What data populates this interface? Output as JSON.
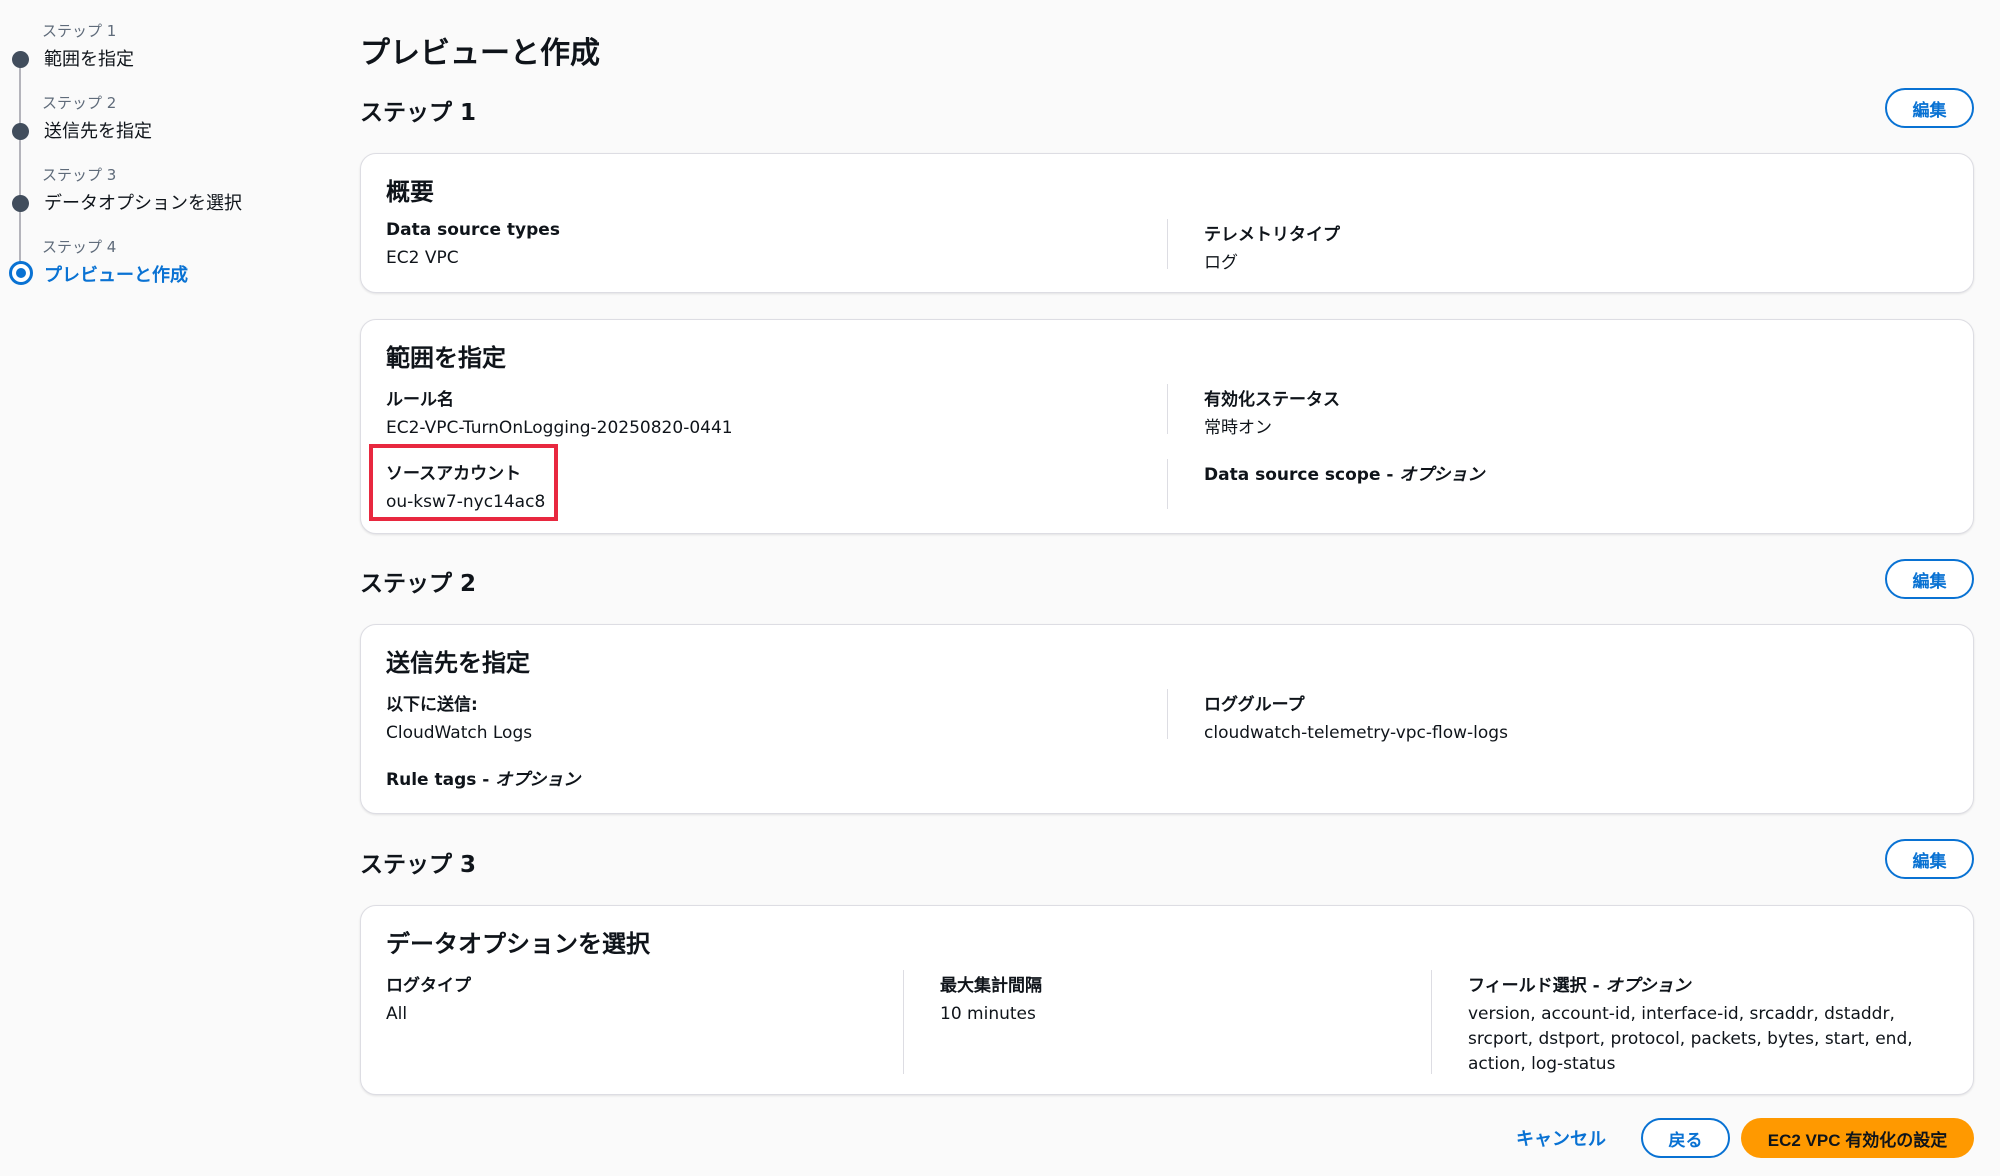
{
  "colors": {
    "accent": "#0972d3",
    "primary_button": "#ff9900",
    "highlight_box": "#e8283f",
    "step_dot": "#414d5c"
  },
  "wizard": {
    "steps": [
      {
        "small": "ステップ 1",
        "name": "範囲を指定",
        "active": false
      },
      {
        "small": "ステップ 2",
        "name": "送信先を指定",
        "active": false
      },
      {
        "small": "ステップ 3",
        "name": "データオプションを選択",
        "active": false
      },
      {
        "small": "ステップ 4",
        "name": "プレビューと作成",
        "active": true
      }
    ]
  },
  "page": {
    "title": "プレビューと作成"
  },
  "edit_label": "編集",
  "step1": {
    "header": "ステップ 1",
    "overview": {
      "title": "概要",
      "data_source_types_label": "Data source types",
      "data_source_types_value": "EC2 VPC",
      "telemetry_type_label": "テレメトリタイプ",
      "telemetry_type_value": "ログ"
    },
    "scope": {
      "title": "範囲を指定",
      "rule_name_label": "ルール名",
      "rule_name_value": "EC2-VPC-TurnOnLogging-20250820-0441",
      "status_label": "有効化ステータス",
      "status_value": "常時オン",
      "source_account_label": "ソースアカウント",
      "source_account_value": "ou-ksw7-nyc14ac8",
      "data_source_scope_label": "Data source scope - ",
      "data_source_scope_optional": "オプション"
    }
  },
  "step2": {
    "header": "ステップ 2",
    "destination": {
      "title": "送信先を指定",
      "send_to_label": "以下に送信:",
      "send_to_value": "CloudWatch Logs",
      "log_group_label": "ロググループ",
      "log_group_value": "cloudwatch-telemetry-vpc-flow-logs",
      "rule_tags_label": "Rule tags - ",
      "rule_tags_optional": "オプション"
    }
  },
  "step3": {
    "header": "ステップ 3",
    "data_options": {
      "title": "データオプションを選択",
      "log_type_label": "ログタイプ",
      "log_type_value": "All",
      "max_interval_label": "最大集計間隔",
      "max_interval_value": "10 minutes",
      "fields_label": "フィールド選択 - ",
      "fields_optional": "オプション",
      "fields_value": "version, account-id, interface-id, srcaddr, dstaddr, srcport, dstport, protocol, packets, bytes, start, end, action, log-status"
    }
  },
  "footer": {
    "cancel_label": "キャンセル",
    "back_label": "戻る",
    "submit_label": "EC2 VPC 有効化の設定"
  }
}
